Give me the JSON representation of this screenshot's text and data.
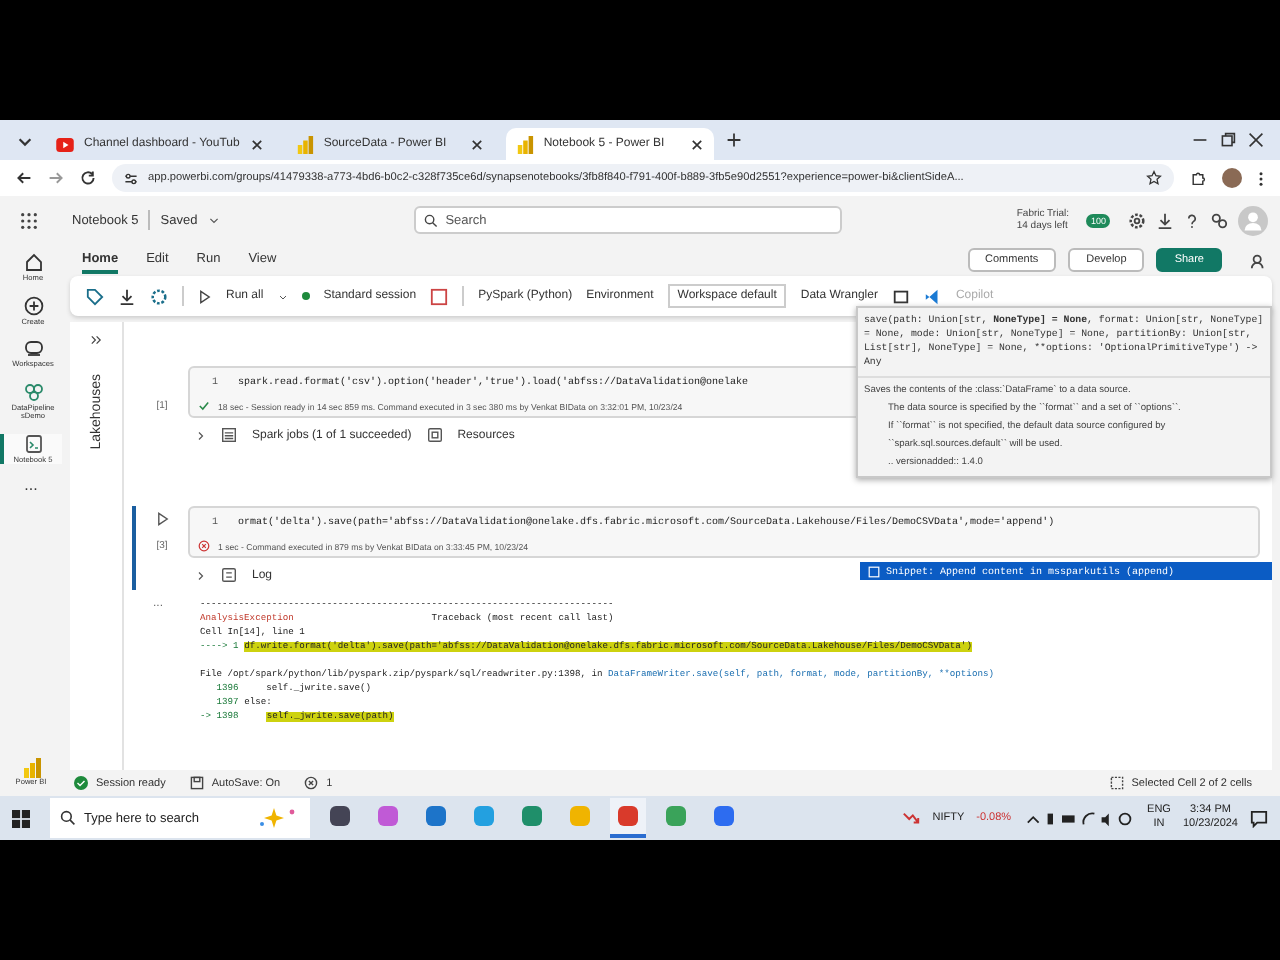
{
  "browser_tabs": [
    {
      "title": "Channel dashboard - YouTub",
      "kind": "youtube",
      "selected": false
    },
    {
      "title": "SourceData - Power BI",
      "kind": "powerbi",
      "selected": false
    },
    {
      "title": "Notebook 5 - Power BI",
      "kind": "powerbi",
      "selected": true
    }
  ],
  "address": {
    "url": "app.powerbi.com/groups/41479338-a773-4bd6-b0c2-c328f735ce6d/synapsenotebooks/3fb8f840-f791-400f-b889-3fb5e90d2551?experience=power-bi&clientSideA..."
  },
  "app_header": {
    "name": "Notebook 5",
    "status": "Saved",
    "search_placeholder": "Search",
    "trial_title": "Fabric Trial:",
    "trial_days": "14 days left",
    "notification_count": "100"
  },
  "nav": {
    "items": [
      {
        "label": "Home",
        "kind": "home",
        "selected": false
      },
      {
        "label": "Create",
        "kind": "create",
        "selected": false
      },
      {
        "label": "Workspaces",
        "kind": "workspaces",
        "selected": false
      },
      {
        "label": "DataPipeline sDemo",
        "kind": "pipeline",
        "selected": false
      },
      {
        "label": "Notebook 5",
        "kind": "notebook",
        "selected": true
      }
    ],
    "more": "...",
    "brand": "Power BI"
  },
  "ribbon": {
    "tabs": [
      {
        "label": "Home",
        "selected": true
      },
      {
        "label": "Edit",
        "selected": false
      },
      {
        "label": "Run",
        "selected": false
      },
      {
        "label": "View",
        "selected": false
      }
    ],
    "comments": "Comments",
    "develop": "Develop",
    "share": "Share"
  },
  "toolbar": {
    "run_all": "Run all",
    "session": "Standard session",
    "language": "PySpark (Python)",
    "environment_label": "Environment",
    "environment": "Workspace default",
    "data_wrangler": "Data Wrangler",
    "copilot": "Copilot",
    "copilot_disabled": true
  },
  "side_panel": {
    "title": "Lakehouses"
  },
  "cells": [
    {
      "exec": "[1]",
      "line_number": "1",
      "code": "spark.read.format('csv').option('header','true').load('abfss://DataValidation@onelake",
      "failed": false,
      "status_text": "18 sec - Session ready in 14 sec 859 ms. Command executed in 3 sec 380 ms by Venkat BIData on 3:32:01 PM, 10/23/24",
      "outputs": [
        {
          "kind": "jobs",
          "label": "Spark jobs (1 of 1 succeeded)"
        },
        {
          "kind": "resources",
          "label": "Resources"
        }
      ]
    },
    {
      "exec": "[3]",
      "line_number": "1",
      "code": "ormat('delta').save(path='abfss://DataValidation@onelake.dfs.fabric.microsoft.com/SourceData.Lakehouse/Files/DemoCSVData',mode='append')",
      "failed": true,
      "status_text": "1 sec - Command executed in 879 ms by Venkat BIData on 3:33:45 PM, 10/23/24",
      "outputs": [
        {
          "kind": "log",
          "label": "Log"
        }
      ]
    }
  ],
  "error_output": {
    "more": "...",
    "lines": [
      {
        "segments": [
          {
            "text": "---------------------------------------------------------------------------",
            "kind": "plain"
          }
        ]
      },
      {
        "segments": [
          {
            "text": "AnalysisException",
            "kind": "exception"
          },
          {
            "text": "                         Traceback (most recent call last)",
            "kind": "plain"
          }
        ]
      },
      {
        "segments": [
          {
            "text": "Cell In[14], line 1",
            "kind": "plain"
          }
        ]
      },
      {
        "segments": [
          {
            "text": "----> 1 ",
            "kind": "arrow"
          },
          {
            "text": "df.write.format('delta').save(path='abfss://DataValidation@onelake.dfs.fabric.microsoft.com/SourceData.Lakehouse/Files/DemoCSVData')",
            "kind": "current"
          }
        ]
      },
      {
        "segments": [
          {
            "text": "File /opt/spark/python/lib/pyspark.zip/pyspark/sql/readwriter.py:1398, in ",
            "kind": "plain"
          },
          {
            "text": "DataFrameWriter.save(self, path, format, mode, partitionBy, **options)",
            "kind": "function"
          }
        ]
      },
      {
        "segments": [
          {
            "text": "   1396",
            "kind": "lineno"
          },
          {
            "text": "     self._jwrite.save()",
            "kind": "plain"
          }
        ]
      },
      {
        "segments": [
          {
            "text": "   1397",
            "kind": "lineno"
          },
          {
            "text": " else:",
            "kind": "plain"
          }
        ]
      },
      {
        "segments": [
          {
            "text": "-> 1398",
            "kind": "lineno"
          },
          {
            "text": "self._jwrite.save(path)",
            "kind": "current"
          }
        ]
      }
    ]
  },
  "tooltip": {
    "signature": "save(path: Union[str, **NoneType] = None**, format: Union[str, NoneType] = None, mode: Union[str, NoneType] = None, partitionBy: Union[str, List[str], NoneType] = None, **options: 'OptionalPrimitiveType') -> Any",
    "doc": [
      {
        "text": "Saves the contents of the :class:`DataFrame` to a data source.",
        "indent": false
      },
      {
        "text": "The data source is specified by the ``format`` and a set of ``options``.",
        "indent": true
      },
      {
        "text": "If ``format`` is not specified, the default data source configured by",
        "indent": true
      },
      {
        "text": "``spark.sql.sources.default`` will be used.",
        "indent": true
      },
      {
        "text": ".. versionadded:: 1.4.0",
        "indent": true
      }
    ]
  },
  "suggestion": {
    "label": "Snippet: Append content in mssparkutils (append)",
    "selected": true
  },
  "status_bar": {
    "session": "Session ready",
    "autosave": "AutoSave: On",
    "errors": "1",
    "selection": "Selected Cell 2 of 2 cells"
  },
  "taskbar": {
    "search_placeholder": "Type here to search",
    "apps": [
      {
        "kind": "widgets",
        "selected": false
      },
      {
        "kind": "copilot",
        "selected": false
      },
      {
        "kind": "mail",
        "selected": false
      },
      {
        "kind": "vscode",
        "selected": false
      },
      {
        "kind": "edge",
        "selected": false
      },
      {
        "kind": "explorer",
        "selected": false
      },
      {
        "kind": "chrome",
        "selected": true
      },
      {
        "kind": "notepad",
        "selected": false
      },
      {
        "kind": "zoom",
        "selected": false
      }
    ],
    "ticker": "NIFTY",
    "change": "-0.08%",
    "lang_top": "ENG",
    "lang_bottom": "IN",
    "time": "3:34 PM",
    "date": "10/23/2024"
  }
}
